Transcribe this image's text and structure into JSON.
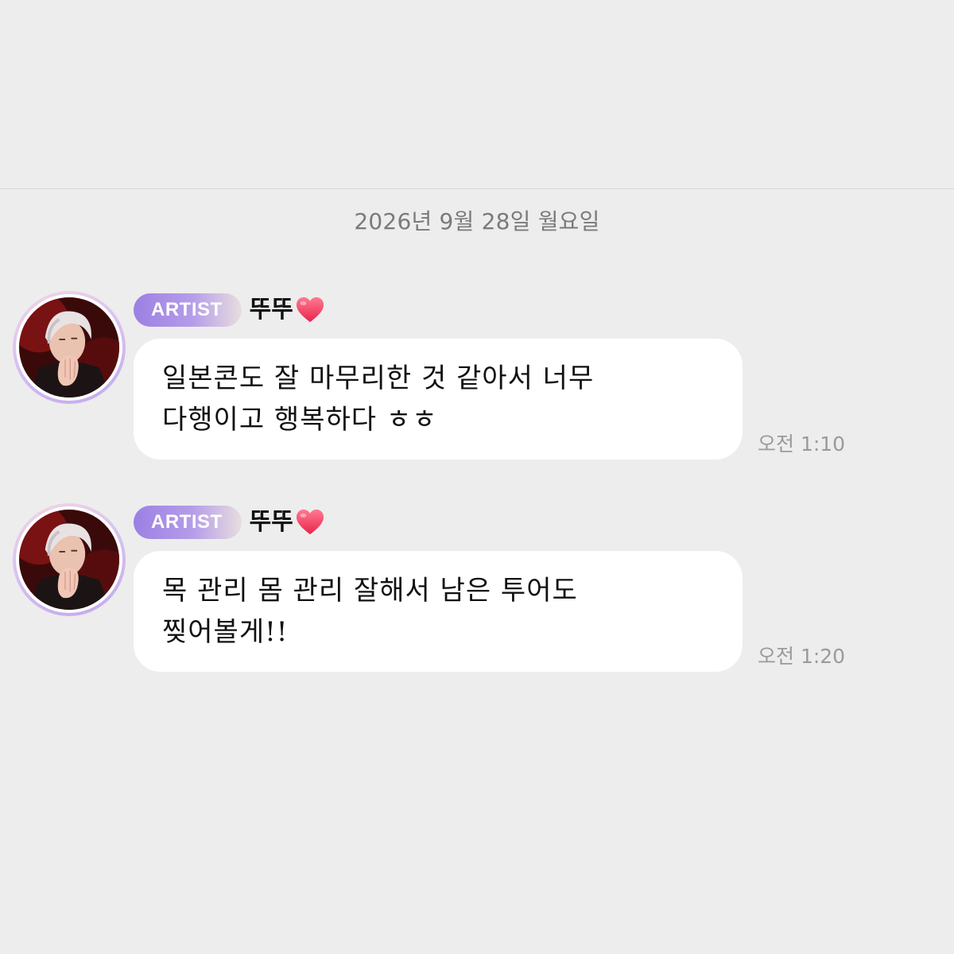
{
  "date_separator": "2026년 9월 28일 월요일",
  "messages": [
    {
      "badge": "ARTIST",
      "sender": "뚜뚜",
      "text": "일본콘도 잘 마무리한 것 같아서 너무\n다행이고 행복하다 ㅎㅎ",
      "time": "오전 1:10"
    },
    {
      "badge": "ARTIST",
      "sender": "뚜뚜",
      "text": "목 관리 몸 관리 잘해서 남은 투어도\n찢어볼게!!",
      "time": "오전 1:20"
    }
  ],
  "icons": {
    "avatar": "artist-avatar-illustration",
    "heart": "red-heart-icon"
  },
  "colors": {
    "background": "#ededed",
    "bubble": "#ffffff",
    "badge_start": "#9c80e3",
    "badge_end": "#e8dede",
    "heart": "#f0476b",
    "date_text": "#7a7a7a",
    "time_text": "#9a9a9a"
  }
}
